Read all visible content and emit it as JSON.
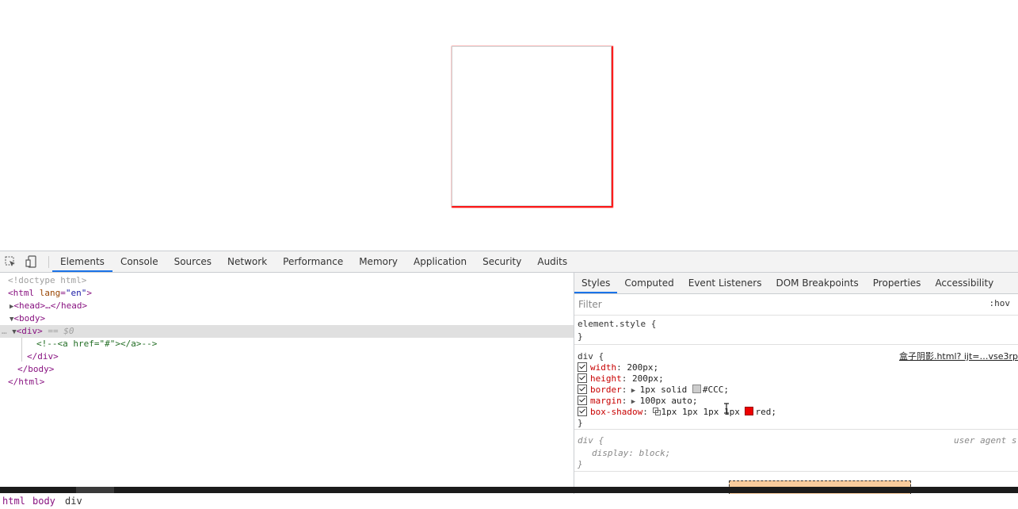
{
  "devtools": {
    "tabs": [
      {
        "label": "Elements",
        "active": true
      },
      {
        "label": "Console",
        "active": false
      },
      {
        "label": "Sources",
        "active": false
      },
      {
        "label": "Network",
        "active": false
      },
      {
        "label": "Performance",
        "active": false
      },
      {
        "label": "Memory",
        "active": false
      },
      {
        "label": "Application",
        "active": false
      },
      {
        "label": "Security",
        "active": false
      },
      {
        "label": "Audits",
        "active": false
      }
    ],
    "toolbar_icons": [
      "inspect-element-icon",
      "device-toolbar-icon"
    ],
    "dom": {
      "doctype": "<!doctype html>",
      "html_tag_open": "<html",
      "html_attr_name": "lang",
      "html_attr_value": "\"en\"",
      "head_collapsed": "<head>…</head>",
      "body_open": "<body>",
      "div_open": "<div>",
      "selected_marker": "== $0",
      "comment": "<!--<a href=\"#\"></a>-->",
      "div_close": "</div>",
      "body_close": "</body>",
      "html_close": "</html>"
    },
    "breadcrumbs": [
      "html",
      "body",
      "div"
    ],
    "styles": {
      "subtabs": [
        {
          "label": "Styles",
          "active": true
        },
        {
          "label": "Computed",
          "active": false
        },
        {
          "label": "Event Listeners",
          "active": false
        },
        {
          "label": "DOM Breakpoints",
          "active": false
        },
        {
          "label": "Properties",
          "active": false
        },
        {
          "label": "Accessibility",
          "active": false
        }
      ],
      "filter_placeholder": "Filter",
      "hov_label": ":hov",
      "element_style": "element.style {",
      "close_brace": "}",
      "rule_selector": "div {",
      "rule_source": "盒子阴影.html? ijt=…vse3rp",
      "properties": [
        {
          "name": "width",
          "value": "200px;"
        },
        {
          "name": "height",
          "value": "200px;"
        },
        {
          "name": "border",
          "value": "1px solid #CCC;",
          "swatch": "#cccccc"
        },
        {
          "name": "margin",
          "value": "100px auto;"
        },
        {
          "name": "box-shadow",
          "value": "1px 1px 1px 1px red;",
          "swatch": "#ff0000"
        }
      ],
      "ua_selector": "div {",
      "ua_label": "user agent s",
      "ua_property_name": "display",
      "ua_property_value": "block;"
    }
  },
  "colors": {
    "shadow": "#ff0000",
    "border": "#cccccc",
    "accent": "#1a73e8"
  }
}
